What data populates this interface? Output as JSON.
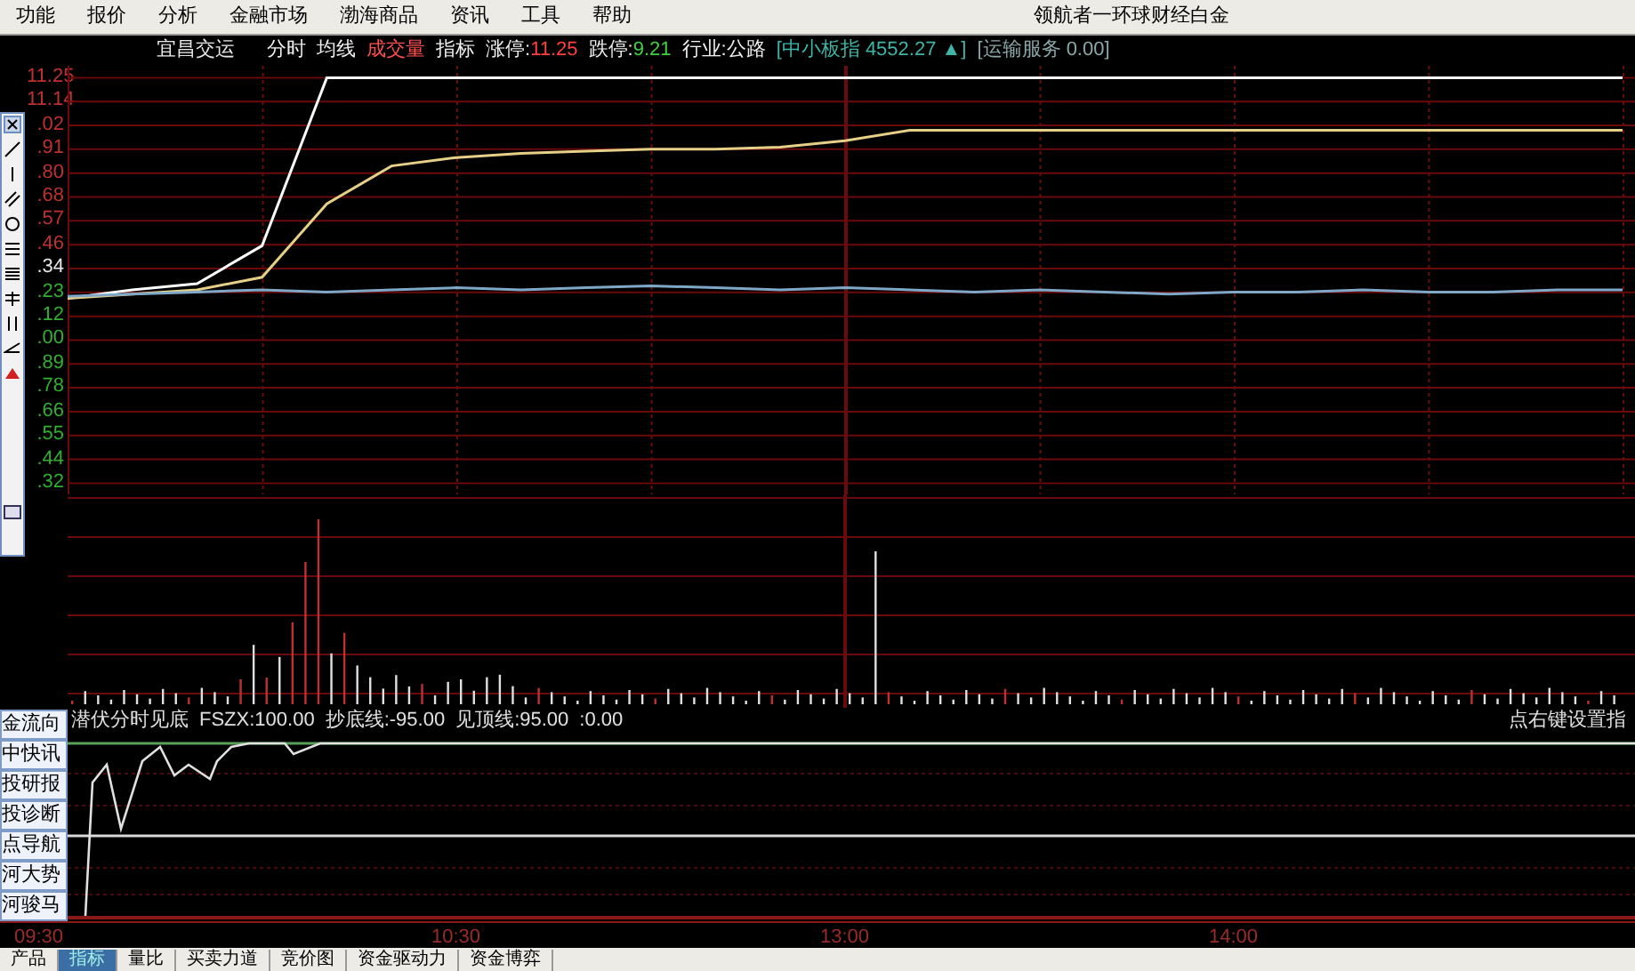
{
  "menu": {
    "items": [
      "功能",
      "报价",
      "分析",
      "金融市场",
      "渤海商品",
      "资讯",
      "工具",
      "帮助"
    ],
    "right_title": "领航者一环球财经白金"
  },
  "quote_header": {
    "stock_name": "宜昌交运",
    "tabs": [
      "分时",
      "均线",
      "成交量",
      "指标"
    ],
    "limit_up": {
      "label": "涨停:",
      "value": "11.25"
    },
    "limit_down": {
      "label": "跌停:",
      "value": "9.21"
    },
    "industry": "行业:公路",
    "index_quote": "[中小板指 4552.27 ▲]",
    "sector_quote": "[运输服务 0.00]"
  },
  "price_chart": {
    "price_labels": [
      "11.25",
      "11.14",
      ".02",
      ".91",
      ".80",
      ".68",
      ".57",
      ".46",
      ".34",
      ".23",
      ".12",
      ".00",
      ".89",
      ".78",
      ".66",
      ".55",
      ".44",
      ".32"
    ],
    "time_labels": [
      "09:30",
      "10:30",
      "13:00",
      "14:00"
    ]
  },
  "indicator": {
    "title": "潜伏分时见底",
    "values": [
      "FSZX:100.00",
      "抄底线:-95.00",
      "见顶线:95.00",
      ":0.00"
    ],
    "hint": "点右键设置指"
  },
  "left_tabs": [
    "金流向",
    "中快讯",
    "投研报",
    "投诊断",
    "点导航",
    "河大势",
    "河骏马"
  ],
  "bottom_tabs": [
    {
      "label": "产品",
      "selected": false
    },
    {
      "label": "指标",
      "selected": true
    },
    {
      "label": "量比",
      "selected": false
    },
    {
      "label": "买卖力道",
      "selected": false
    },
    {
      "label": "竞价图",
      "selected": false
    },
    {
      "label": "资金驱动力",
      "selected": false
    },
    {
      "label": "资金博弈",
      "selected": false
    }
  ]
}
